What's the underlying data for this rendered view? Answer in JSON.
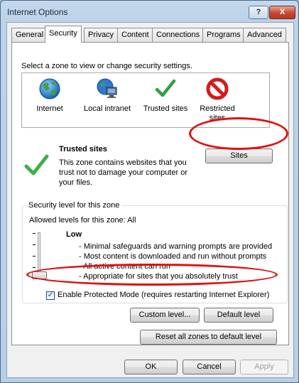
{
  "window": {
    "title": "Internet Options",
    "help_glyph": "?",
    "close_glyph": "X"
  },
  "tabs": [
    "General",
    "Security",
    "Privacy",
    "Content",
    "Connections",
    "Programs",
    "Advanced"
  ],
  "active_tab": "Security",
  "security": {
    "zone_prompt": "Select a zone to view or change security settings.",
    "zones": [
      {
        "label": "Internet",
        "icon": "globe-icon"
      },
      {
        "label": "Local intranet",
        "icon": "intranet-icon"
      },
      {
        "label": "Trusted sites",
        "icon": "checkmark-icon",
        "selected": true
      },
      {
        "label": "Restricted sites",
        "label_lines": [
          "Restricted",
          "sites"
        ],
        "icon": "restricted-icon"
      }
    ],
    "zone_title": "Trusted sites",
    "zone_description_lines": [
      "This zone contains websites that you",
      "trust not to damage your computer or",
      "your files."
    ],
    "sites_button": "Sites",
    "level_group_title": "Security level for this zone",
    "allowed_levels": "Allowed levels for this zone: All",
    "level_name": "Low",
    "level_bullets": [
      "- Minimal safeguards and warning prompts are provided",
      "- Most content is downloaded and run without prompts",
      "- All active content can run",
      "- Appropriate for sites that you absolutely trust"
    ],
    "protected_mode": {
      "checked": true,
      "label": "Enable Protected Mode (requires restarting Internet Explorer)"
    },
    "custom_level_button": "Custom level...",
    "default_level_button": "Default level",
    "reset_button": "Reset all zones to default level"
  },
  "footer": {
    "ok": "OK",
    "cancel": "Cancel",
    "apply": "Apply"
  },
  "colors": {
    "annotation_red": "#e01010",
    "selection_blue": "#3399ff",
    "check_green": "#3cb043"
  }
}
